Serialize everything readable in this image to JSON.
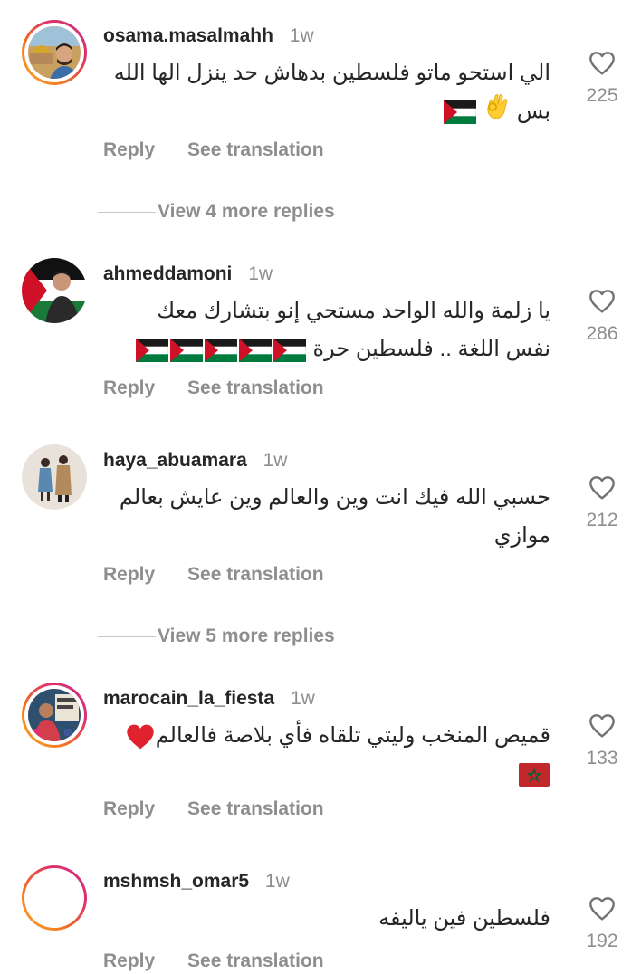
{
  "comments": [
    {
      "username": "osama.masalmahh",
      "time": "1w",
      "line1": "الي استحو ماتو فلسطين بدهاش حد ينزل الها الله",
      "line2": "بس",
      "likes": "225",
      "reply": "Reply",
      "translate": "See translation",
      "emojis": [
        "ok-hand",
        "palestine-flag"
      ]
    },
    {
      "username": "ahmeddamoni",
      "time": "1w",
      "line1": "يا زلمة والله الواحد مستحي إنو بتشارك معك",
      "line2": "نفس اللغة .. فلسطين حرة",
      "likes": "286",
      "reply": "Reply",
      "translate": "See translation",
      "emojis": [
        "palestine-flag",
        "palestine-flag",
        "palestine-flag",
        "palestine-flag",
        "palestine-flag"
      ]
    },
    {
      "username": "haya_abuamara",
      "time": "1w",
      "line1": "حسبي الله فيك انت وين والعالم وين عايش بعالم",
      "line2": "موازي",
      "likes": "212",
      "reply": "Reply",
      "translate": "See translation"
    },
    {
      "username": "marocain_la_fiesta",
      "time": "1w",
      "line1": "قميص المنخب وليتي تلقاه فأي بلاصة فالعالم",
      "line2": "",
      "likes": "133",
      "reply": "Reply",
      "translate": "See translation",
      "emojis": [
        "red-heart",
        "morocco-flag"
      ]
    },
    {
      "username": "mshmsh_omar5",
      "time": "1w",
      "line1": "فلسطين فين ياليفه",
      "likes": "192",
      "reply": "Reply",
      "translate": "See translation"
    }
  ],
  "more_replies": [
    {
      "label": "View 4 more replies"
    },
    {
      "label": "View 5 more replies"
    }
  ],
  "colors": {
    "text": "#262626",
    "muted": "#8e8e8e",
    "palestine_red": "#ce1126",
    "palestine_green": "#007a3d",
    "morocco_red": "#c1272d"
  }
}
